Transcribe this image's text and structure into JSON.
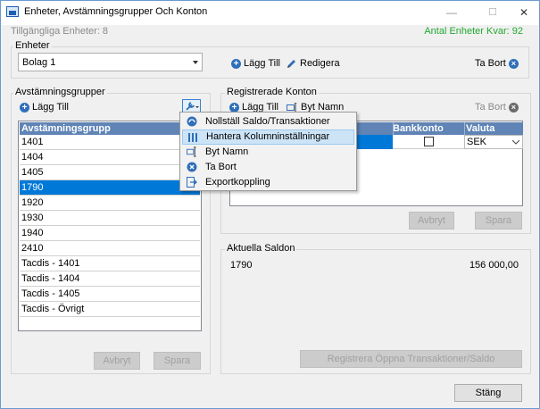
{
  "window": {
    "title": "Enheter, Avstämningsgrupper Och Konton",
    "minimize": "—",
    "maximize": "☐",
    "close": "✕"
  },
  "top": {
    "available_units": "Tillgängliga Enheter: 8",
    "units_left": "Antal Enheter Kvar: 92",
    "units_left_color": "#22a830"
  },
  "units": {
    "group_title": "Enheter",
    "selected": "Bolag 1",
    "add": "Lägg Till",
    "edit": "Redigera",
    "delete": "Ta Bort"
  },
  "groups": {
    "group_title": "Avstämningsgrupper",
    "add": "Lägg Till",
    "column_header": "Avstämningsgrupp",
    "rows": [
      "1401",
      "1404",
      "1405",
      "1790",
      "1920",
      "1930",
      "1940",
      "2410",
      "Tacdis - 1401",
      "Tacdis - 1404",
      "Tacdis - 1405",
      "Tacdis - Övrigt"
    ],
    "selected_index": 3,
    "cancel": "Avbryt",
    "save": "Spara"
  },
  "context_menu": {
    "items": [
      {
        "label": "Nollställ Saldo/Transaktioner",
        "icon": "reset-icon"
      },
      {
        "label": "Hantera Kolumninställningar",
        "icon": "columns-icon",
        "highlighted": true
      },
      {
        "label": "Byt Namn",
        "icon": "rename-icon"
      },
      {
        "label": "Ta Bort",
        "icon": "delete-icon"
      },
      {
        "label": "Exportkoppling",
        "icon": "export-icon"
      }
    ]
  },
  "accounts": {
    "group_title": "Registrerade Konton",
    "add": "Lägg Till",
    "rename": "Byt Namn",
    "delete": "Ta Bort",
    "columns": [
      "",
      "Bankkonto",
      "Valuta"
    ],
    "row": {
      "currency": "SEK"
    },
    "cancel": "Avbryt",
    "save": "Spara"
  },
  "balances": {
    "group_title": "Aktuella Saldon",
    "account": "1790",
    "amount": "156 000,00",
    "register_button": "Registrera Öppna Transaktioner/Saldo"
  },
  "footer": {
    "close": "Stäng"
  }
}
